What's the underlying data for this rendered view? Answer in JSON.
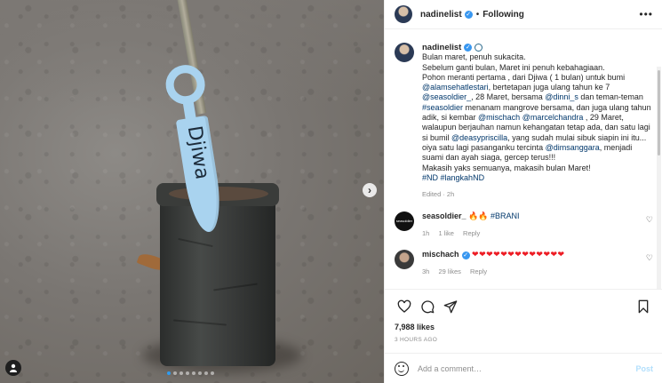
{
  "photo": {
    "tag_word": "Djiwa",
    "dots_count": 8,
    "active_dot": 0
  },
  "header": {
    "username": "nadinelist",
    "separator": "•",
    "follow_label": "Following",
    "more_label": "•••"
  },
  "caption": {
    "username": "nadinelist",
    "lines": [
      "Bulan maret, penuh sukacita.",
      "Sebelum ganti bulan, Maret ini penuh kebahagiaan.",
      "Pohon meranti pertama , dari Djiwa ( 1 bulan) untuk bumi"
    ],
    "mention_1": "@alamsehatlestari",
    "text_1": ", bertetapan juga ulang tahun ke 7 ",
    "mention_2": "@seasoldier_",
    "text_2": ", 28 Maret, bersama ",
    "mention_3": "@dinni_s",
    "text_3": " dan teman-teman ",
    "hashtag_1": "#seasoldier",
    "text_4": " menanam mangrove bersama, dan juga ulang tahun adik, si kembar ",
    "mention_4": "@mischach",
    "mention_5": "@marcelchandra",
    "text_5": " , 29 Maret, walaupun berjauhan namun kehangatan tetap ada, dan satu lagi si bumil ",
    "mention_6": "@deasypriscilla",
    "text_6": ", yang sudah mulai sibuk siapin ini itu... oiya satu lagi pasanganku tercinta ",
    "mention_7": "@dimsanggara",
    "text_7": ", menjadi suami dan ayah siaga, gercep terus!!!",
    "text_8": "Makasih yaks semuanya, makasih bulan Maret!",
    "hashtag_2": "#ND",
    "hashtag_3": "#langkahND",
    "meta": "Edited · 2h"
  },
  "comments": [
    {
      "username": "seasoldier_",
      "avatar_text": "seasoldier",
      "text": "🔥🔥",
      "link": "#BRANI",
      "time": "1h",
      "likes": "1 like",
      "reply": "Reply"
    },
    {
      "username": "mischach",
      "text": "❤❤❤❤❤❤❤❤❤❤❤❤❤",
      "time": "3h",
      "likes": "29 likes",
      "reply": "Reply"
    }
  ],
  "likes": "7,988 likes",
  "ago": "3 HOURS AGO",
  "comment_box": {
    "placeholder": "Add a comment…",
    "post_label": "Post"
  }
}
